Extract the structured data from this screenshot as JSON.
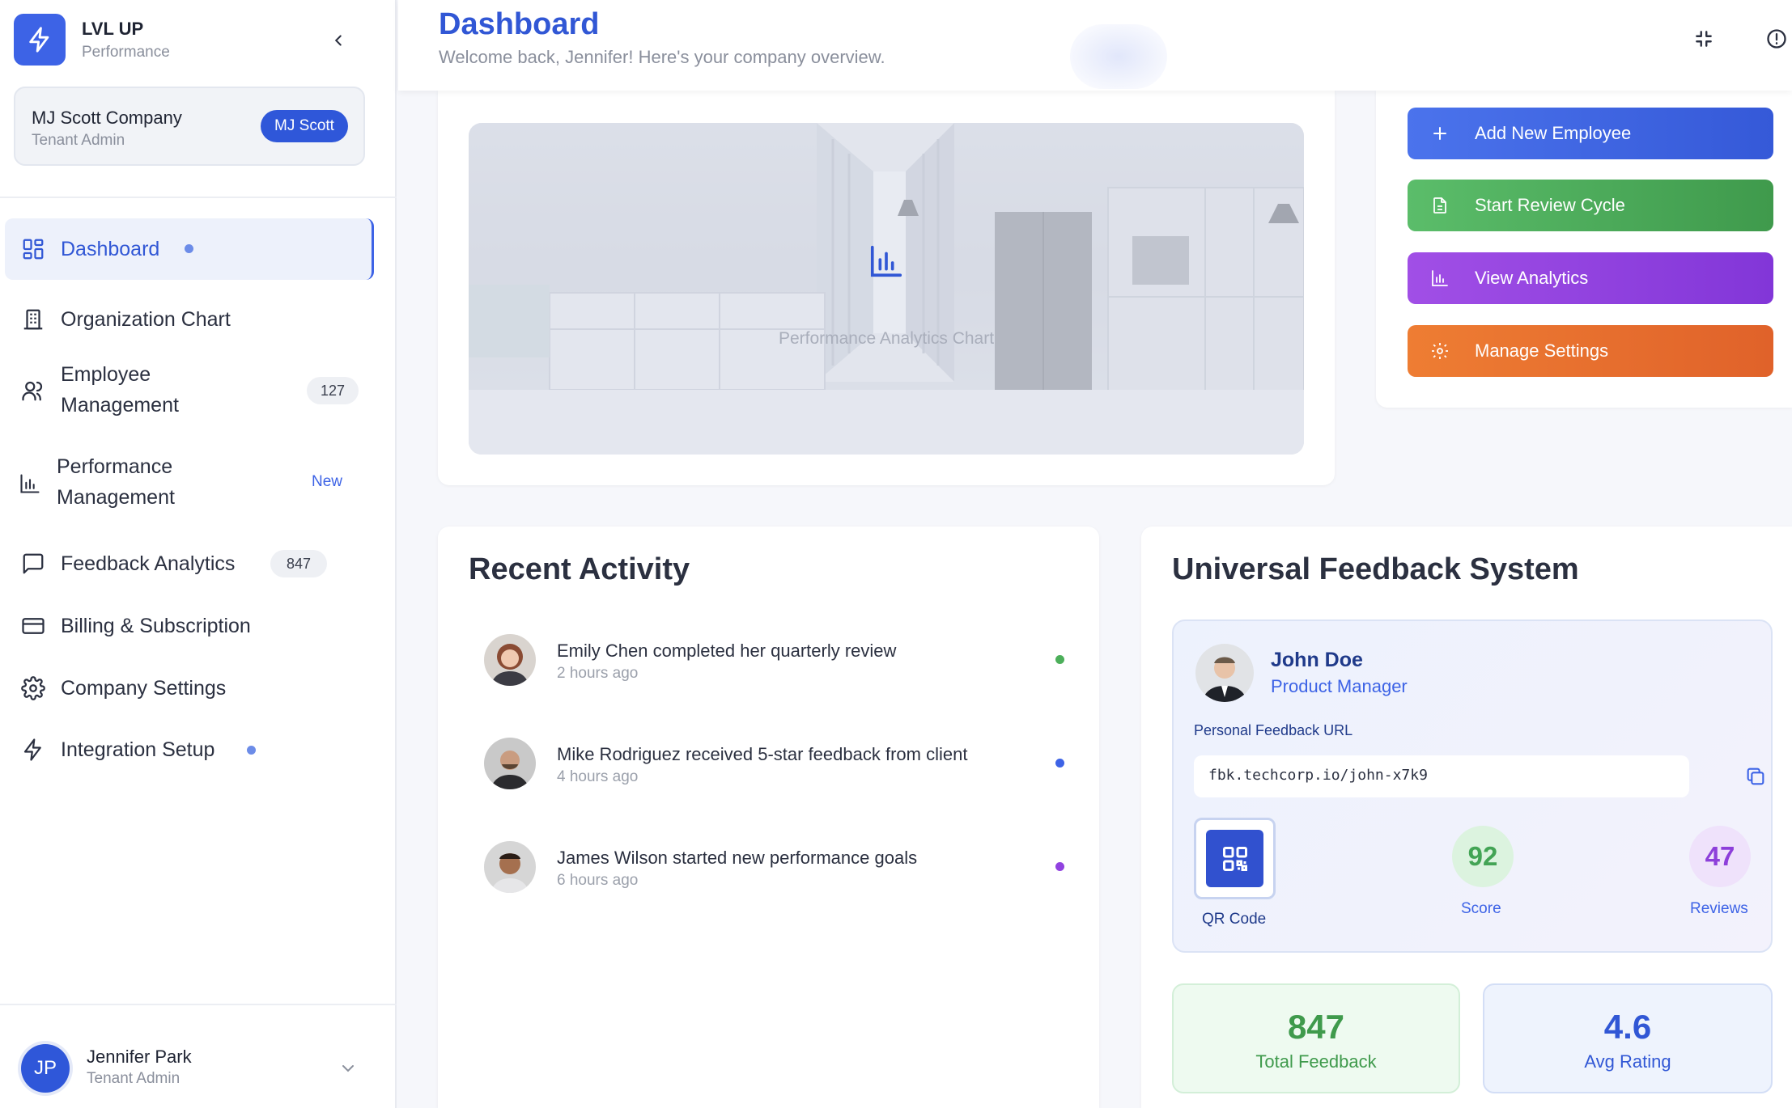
{
  "brand": {
    "name": "LVL UP",
    "subtitle": "Performance"
  },
  "tenant": {
    "company": "MJ Scott Company",
    "role": "Tenant Admin",
    "badge": "MJ Scott"
  },
  "nav": {
    "items": [
      {
        "label": "Dashboard",
        "icon": "grid-icon",
        "active": true,
        "indicator": "dot"
      },
      {
        "label": "Organization Chart",
        "icon": "building-icon"
      },
      {
        "label": "Employee Management",
        "icon": "users-icon",
        "badge": "127"
      },
      {
        "label": "Performance Management",
        "icon": "bar-chart-icon",
        "badge": "New"
      },
      {
        "label": "Feedback Analytics",
        "icon": "message-square-icon",
        "badge": "847"
      },
      {
        "label": "Billing & Subscription",
        "icon": "credit-card-icon"
      },
      {
        "label": "Company Settings",
        "icon": "gear-icon"
      },
      {
        "label": "Integration Setup",
        "icon": "zap-icon",
        "indicator": "dot"
      }
    ]
  },
  "user": {
    "initials": "JP",
    "name": "Jennifer Park",
    "role": "Tenant Admin"
  },
  "header": {
    "title": "Dashboard",
    "subtitle": "Welcome back, Jennifer! Here's your company overview.",
    "icons": [
      "collapse-icon",
      "alert-circle-icon"
    ]
  },
  "chart_card": {
    "caption": "Performance Analytics Chart",
    "icon": "bar-chart-icon"
  },
  "quick_actions": [
    {
      "label": "Add New Employee",
      "icon": "plus-icon",
      "color": "#3d63e6"
    },
    {
      "label": "Start Review Cycle",
      "icon": "document-icon",
      "color": "#4caf5a"
    },
    {
      "label": "View Analytics",
      "icon": "bar-chart-icon",
      "color": "#9142e0"
    },
    {
      "label": "Manage Settings",
      "icon": "gear-icon",
      "color": "#e8702f"
    }
  ],
  "recent_activity": {
    "title": "Recent Activity",
    "items": [
      {
        "text": "Emily Chen completed her quarterly review",
        "time": "2 hours ago",
        "status_color": "#4caf5a"
      },
      {
        "text": "Mike Rodriguez received 5-star feedback from client",
        "time": "4 hours ago",
        "status_color": "#3d63e6"
      },
      {
        "text": "James Wilson started new performance goals",
        "time": "6 hours ago",
        "status_color": "#9142e0"
      }
    ]
  },
  "feedback_system": {
    "title": "Universal Feedback System",
    "profile": {
      "name": "John Doe",
      "title": "Product Manager"
    },
    "url_label": "Personal Feedback URL",
    "url": "fbk.techcorp.io/john-x7k9",
    "qr_label": "QR Code",
    "score": {
      "value": "92",
      "label": "Score"
    },
    "reviews": {
      "value": "47",
      "label": "Reviews"
    },
    "total_feedback": {
      "value": "847",
      "label": "Total Feedback"
    },
    "avg_rating": {
      "value": "4.6",
      "label": "Avg Rating"
    }
  },
  "colors": {
    "accent": "#3d63e6",
    "green": "#4caf5a",
    "purple": "#9142e0",
    "orange": "#e8702f"
  }
}
